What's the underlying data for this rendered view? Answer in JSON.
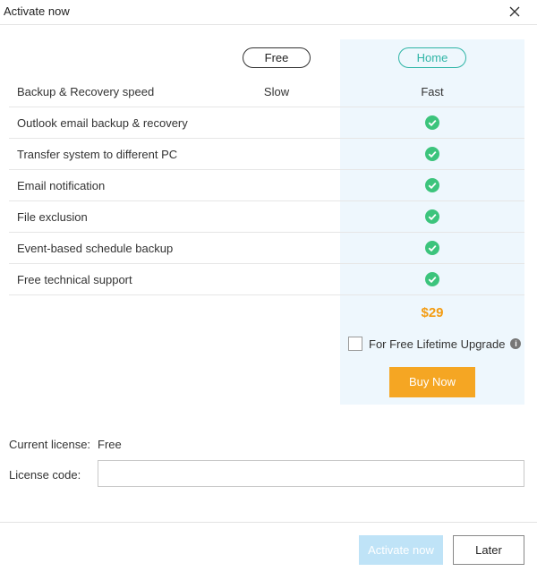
{
  "window": {
    "title": "Activate now",
    "close_icon": "close-icon"
  },
  "plans": {
    "free_label": "Free",
    "home_label": "Home"
  },
  "features": [
    {
      "name": "Backup & Recovery speed",
      "free": "Slow",
      "home": "Fast",
      "home_check": false
    },
    {
      "name": "Outlook email backup & recovery",
      "free": "",
      "home": "",
      "home_check": true
    },
    {
      "name": "Transfer system to different PC",
      "free": "",
      "home": "",
      "home_check": true
    },
    {
      "name": "Email notification",
      "free": "",
      "home": "",
      "home_check": true
    },
    {
      "name": "File exclusion",
      "free": "",
      "home": "",
      "home_check": true
    },
    {
      "name": "Event-based schedule backup",
      "free": "",
      "home": "",
      "home_check": true
    },
    {
      "name": "Free technical support",
      "free": "",
      "home": "",
      "home_check": true
    }
  ],
  "pricing": {
    "price": "$29",
    "upgrade_label": "For Free Lifetime Upgrade",
    "upgrade_checked": false,
    "buy_label": "Buy Now"
  },
  "license": {
    "current_label": "Current license:",
    "current_value": "Free",
    "code_label": "License code:",
    "code_value": ""
  },
  "footer": {
    "activate_label": "Activate now",
    "later_label": "Later"
  },
  "colors": {
    "check_green": "#3cc47c",
    "accent_orange": "#f5a623",
    "price_orange": "#f39c12",
    "home_panel_bg": "#eef7fd",
    "home_pill_teal": "#2fb5a6",
    "activate_disabled": "#bfe3f7"
  }
}
